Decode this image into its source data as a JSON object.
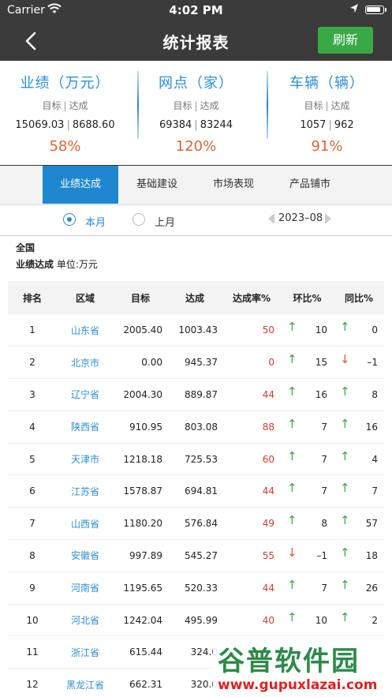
{
  "status_bar": {
    "carrier": "Carrier",
    "time": "4:02 PM"
  },
  "header": {
    "title": "统计报表",
    "refresh_label": "刷新",
    "accent_color": "#39a845"
  },
  "summary": [
    {
      "title": "业绩（万元）",
      "sub_target": "目标",
      "sub_done": "达成",
      "target": "15069.03",
      "done": "8688.60",
      "percent": "58%"
    },
    {
      "title": "网点（家）",
      "sub_target": "目标",
      "sub_done": "达成",
      "target": "69384",
      "done": "83244",
      "percent": "120%"
    },
    {
      "title": "车辆（辆）",
      "sub_target": "目标",
      "sub_done": "达成",
      "target": "1057",
      "done": "962",
      "percent": "91%"
    }
  ],
  "tabs": [
    {
      "label": "业绩达成",
      "active": true
    },
    {
      "label": "基础建设",
      "active": false
    },
    {
      "label": "市场表现",
      "active": false
    },
    {
      "label": "产品铺市",
      "active": false
    }
  ],
  "filter": {
    "this_month": "本月",
    "last_month": "上月",
    "selected": "本月",
    "date": "2023–08"
  },
  "report": {
    "region": "全国",
    "metric": "业绩达成",
    "unit": "单位:万元"
  },
  "table": {
    "headers": [
      "排名",
      "区域",
      "目标",
      "达成",
      "达成率%",
      "环比%",
      "同比%"
    ],
    "rows": [
      {
        "rank": "1",
        "area": "山东省",
        "target": "2005.40",
        "done": "1003.43",
        "rate": "50",
        "mom_dir": "up",
        "mom": "10",
        "yoy_dir": "up",
        "yoy": "0"
      },
      {
        "rank": "2",
        "area": "北京市",
        "target": "0.00",
        "done": "945.37",
        "rate": "0",
        "mom_dir": "up",
        "mom": "15",
        "yoy_dir": "down",
        "yoy": "–1"
      },
      {
        "rank": "3",
        "area": "辽宁省",
        "target": "2004.30",
        "done": "889.87",
        "rate": "44",
        "mom_dir": "up",
        "mom": "16",
        "yoy_dir": "up",
        "yoy": "8"
      },
      {
        "rank": "4",
        "area": "陕西省",
        "target": "910.95",
        "done": "803.08",
        "rate": "88",
        "mom_dir": "up",
        "mom": "7",
        "yoy_dir": "up",
        "yoy": "16"
      },
      {
        "rank": "5",
        "area": "天津市",
        "target": "1218.18",
        "done": "725.53",
        "rate": "60",
        "mom_dir": "up",
        "mom": "7",
        "yoy_dir": "up",
        "yoy": "4"
      },
      {
        "rank": "6",
        "area": "江苏省",
        "target": "1578.87",
        "done": "694.81",
        "rate": "44",
        "mom_dir": "up",
        "mom": "7",
        "yoy_dir": "up",
        "yoy": "7"
      },
      {
        "rank": "7",
        "area": "山西省",
        "target": "1180.20",
        "done": "576.84",
        "rate": "49",
        "mom_dir": "up",
        "mom": "8",
        "yoy_dir": "up",
        "yoy": "57"
      },
      {
        "rank": "8",
        "area": "安徽省",
        "target": "997.89",
        "done": "545.27",
        "rate": "55",
        "mom_dir": "down",
        "mom": "–1",
        "yoy_dir": "up",
        "yoy": "18"
      },
      {
        "rank": "9",
        "area": "河南省",
        "target": "1195.65",
        "done": "520.33",
        "rate": "44",
        "mom_dir": "up",
        "mom": "7",
        "yoy_dir": "up",
        "yoy": "26"
      },
      {
        "rank": "10",
        "area": "河北省",
        "target": "1242.04",
        "done": "495.99",
        "rate": "40",
        "mom_dir": "up",
        "mom": "10",
        "yoy_dir": "up",
        "yoy": "2"
      },
      {
        "rank": "11",
        "area": "浙江省",
        "target": "615.44",
        "done": "324.0",
        "rate": "",
        "mom_dir": "",
        "mom": "",
        "yoy_dir": "",
        "yoy": ""
      },
      {
        "rank": "12",
        "area": "黑龙江省",
        "target": "662.31",
        "done": "320.0",
        "rate": "",
        "mom_dir": "",
        "mom": "",
        "yoy_dir": "",
        "yoy": ""
      }
    ]
  },
  "watermark": {
    "title": "谷普软件园",
    "url": "www.gupuxlazai.com"
  }
}
